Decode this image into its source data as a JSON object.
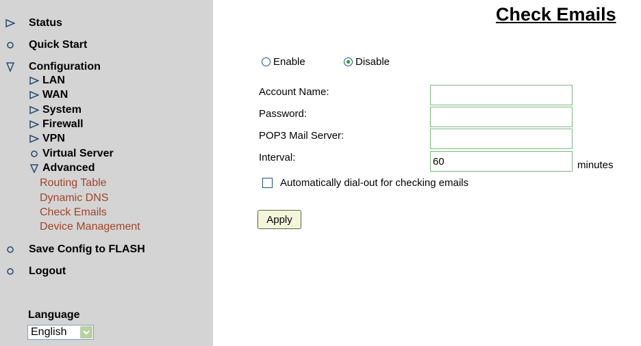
{
  "sidebar": {
    "items": [
      {
        "label": "Status",
        "icon": "triangle-right-icon"
      },
      {
        "label": "Quick Start",
        "icon": "circle-icon"
      },
      {
        "label": "Configuration",
        "icon": "triangle-down-icon"
      },
      {
        "label": "Save Config to FLASH",
        "icon": "circle-icon"
      },
      {
        "label": "Logout",
        "icon": "circle-icon"
      }
    ],
    "config_items": [
      {
        "label": "LAN",
        "icon": "triangle-right-icon"
      },
      {
        "label": "WAN",
        "icon": "triangle-right-icon"
      },
      {
        "label": "System",
        "icon": "triangle-right-icon"
      },
      {
        "label": "Firewall",
        "icon": "triangle-right-icon"
      },
      {
        "label": "VPN",
        "icon": "triangle-right-icon"
      },
      {
        "label": "Virtual Server",
        "icon": "circle-icon"
      },
      {
        "label": "Advanced",
        "icon": "triangle-down-icon"
      }
    ],
    "advanced_items": [
      "Routing Table",
      "Dynamic DNS",
      "Check Emails",
      "Device Management"
    ],
    "language_label": "Language",
    "language_value": "English"
  },
  "main": {
    "title": "Check Emails",
    "enable_label": "Enable",
    "disable_label": "Disable",
    "selected": "Disable",
    "account_name_label": "Account Name:",
    "account_name_value": "",
    "password_label": "Password:",
    "password_value": "",
    "pop3_label": "POP3 Mail Server:",
    "pop3_value": "",
    "interval_label": "Interval:",
    "interval_value": "60",
    "interval_unit": "minutes",
    "autodial_label": "Automatically dial-out for checking emails",
    "autodial_checked": false,
    "apply_label": "Apply"
  },
  "colors": {
    "sidebar_bg": "#d4d4d4",
    "link": "#a0442a",
    "field_border": "#7fb77f"
  }
}
